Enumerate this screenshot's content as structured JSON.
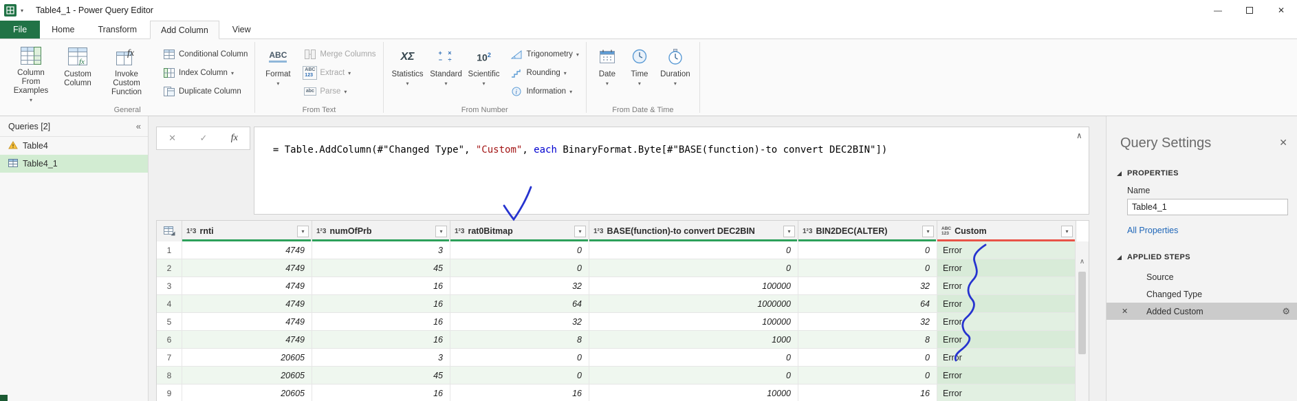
{
  "icons": {
    "minimize": "—",
    "close": "✕",
    "dropdown": "▾",
    "collapse_pane": "«",
    "formula_collapse": "∧",
    "scroll_up": "∧",
    "filter": "▾",
    "cancel": "✕",
    "check": "✓",
    "fx": "fx",
    "gear": "⚙",
    "delete_step": "✕",
    "num_type": "1²3",
    "any_type_top": "ABC",
    "any_type_bottom": "123"
  },
  "titlebar": {
    "title": "Table4_1 - Power Query Editor"
  },
  "tabs": {
    "items": [
      {
        "label": "File"
      },
      {
        "label": "Home"
      },
      {
        "label": "Transform"
      },
      {
        "label": "Add Column"
      },
      {
        "label": "View"
      }
    ]
  },
  "ribbon": {
    "groups": {
      "general": {
        "label": "General",
        "buttons": {
          "column_from_examples": "Column From Examples",
          "custom_column": "Custom Column",
          "invoke_custom_function": "Invoke Custom Function",
          "conditional_column": "Conditional Column",
          "index_column": "Index Column",
          "duplicate_column": "Duplicate Column"
        }
      },
      "from_text": {
        "label": "From Text",
        "buttons": {
          "format": "Format",
          "merge_columns": "Merge Columns",
          "extract": "Extract",
          "parse": "Parse"
        }
      },
      "from_number": {
        "label": "From Number",
        "buttons": {
          "statistics": "Statistics",
          "standard": "Standard",
          "scientific": "Scientific",
          "trigonometry": "Trigonometry",
          "rounding": "Rounding",
          "information": "Information"
        }
      },
      "from_date_time": {
        "label": "From Date & Time",
        "buttons": {
          "date": "Date",
          "time": "Time",
          "duration": "Duration"
        }
      }
    }
  },
  "queries_pane": {
    "header": "Queries [2]",
    "items": [
      {
        "name": "Table4"
      },
      {
        "name": "Table4_1"
      }
    ]
  },
  "formula": {
    "segments": [
      {
        "text": "= Table.AddColumn(#\"Changed Type\", "
      },
      {
        "text": "\"Custom\""
      },
      {
        "text": ", "
      },
      {
        "text": "each"
      },
      {
        "text": " BinaryFormat.Byte[#\"BASE(function)-to convert DEC2BIN\"])"
      }
    ]
  },
  "grid": {
    "columns": [
      {
        "name": "rnti"
      },
      {
        "name": "numOfPrb"
      },
      {
        "name": "rat0Bitmap"
      },
      {
        "name": "BASE(function)-to convert DEC2BIN"
      },
      {
        "name": "BIN2DEC(ALTER)"
      },
      {
        "name": "Custom"
      }
    ],
    "rows": [
      {
        "n": "1",
        "cells": [
          "4749",
          "3",
          "0",
          "0",
          "0",
          "Error"
        ]
      },
      {
        "n": "2",
        "cells": [
          "4749",
          "45",
          "0",
          "0",
          "0",
          "Error"
        ]
      },
      {
        "n": "3",
        "cells": [
          "4749",
          "16",
          "32",
          "100000",
          "32",
          "Error"
        ]
      },
      {
        "n": "4",
        "cells": [
          "4749",
          "16",
          "64",
          "1000000",
          "64",
          "Error"
        ]
      },
      {
        "n": "5",
        "cells": [
          "4749",
          "16",
          "32",
          "100000",
          "32",
          "Error"
        ]
      },
      {
        "n": "6",
        "cells": [
          "4749",
          "16",
          "8",
          "1000",
          "8",
          "Error"
        ]
      },
      {
        "n": "7",
        "cells": [
          "20605",
          "3",
          "0",
          "0",
          "0",
          "Error"
        ]
      },
      {
        "n": "8",
        "cells": [
          "20605",
          "45",
          "0",
          "0",
          "0",
          "Error"
        ]
      },
      {
        "n": "9",
        "cells": [
          "20605",
          "16",
          "16",
          "10000",
          "16",
          "Error"
        ]
      }
    ]
  },
  "query_settings": {
    "title": "Query Settings",
    "properties_label": "PROPERTIES",
    "name_label": "Name",
    "name_value": "Table4_1",
    "all_properties_label": "All Properties",
    "applied_steps_label": "APPLIED STEPS",
    "steps": [
      {
        "label": "Source"
      },
      {
        "label": "Changed Type"
      },
      {
        "label": "Added Custom"
      }
    ]
  },
  "colors": {
    "brand_green": "#217346",
    "quality_ok_green": "#2ca05a",
    "quality_error_red": "#e85347",
    "selection_green": "#d2ecd2",
    "link_blue": "#1e66b8",
    "annotation_blue": "#2633cf",
    "string_red": "#a31515",
    "keyword_blue": "#0000d0"
  }
}
